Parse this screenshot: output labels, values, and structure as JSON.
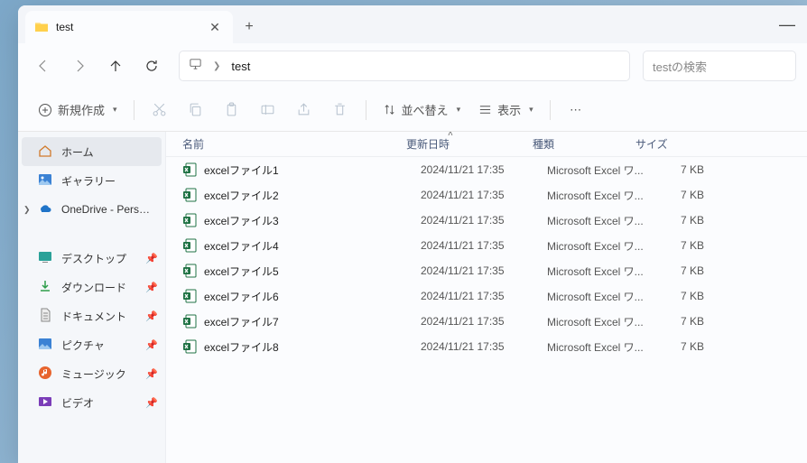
{
  "tab": {
    "title": "test"
  },
  "address": {
    "path": "test"
  },
  "search": {
    "placeholder": "testの検索"
  },
  "toolbar": {
    "new": "新規作成",
    "sort": "並べ替え",
    "view": "表示"
  },
  "sidebar": {
    "home": "ホーム",
    "gallery": "ギャラリー",
    "onedrive": "OneDrive - Pers…",
    "desktop": "デスクトップ",
    "downloads": "ダウンロード",
    "documents": "ドキュメント",
    "pictures": "ピクチャ",
    "music": "ミュージック",
    "videos": "ビデオ"
  },
  "columns": {
    "name": "名前",
    "date": "更新日時",
    "type": "種類",
    "size": "サイズ"
  },
  "files": [
    {
      "name": "excelファイル1",
      "date": "2024/11/21 17:35",
      "type": "Microsoft Excel ワ...",
      "size": "7 KB"
    },
    {
      "name": "excelファイル2",
      "date": "2024/11/21 17:35",
      "type": "Microsoft Excel ワ...",
      "size": "7 KB"
    },
    {
      "name": "excelファイル3",
      "date": "2024/11/21 17:35",
      "type": "Microsoft Excel ワ...",
      "size": "7 KB"
    },
    {
      "name": "excelファイル4",
      "date": "2024/11/21 17:35",
      "type": "Microsoft Excel ワ...",
      "size": "7 KB"
    },
    {
      "name": "excelファイル5",
      "date": "2024/11/21 17:35",
      "type": "Microsoft Excel ワ...",
      "size": "7 KB"
    },
    {
      "name": "excelファイル6",
      "date": "2024/11/21 17:35",
      "type": "Microsoft Excel ワ...",
      "size": "7 KB"
    },
    {
      "name": "excelファイル7",
      "date": "2024/11/21 17:35",
      "type": "Microsoft Excel ワ...",
      "size": "7 KB"
    },
    {
      "name": "excelファイル8",
      "date": "2024/11/21 17:35",
      "type": "Microsoft Excel ワ...",
      "size": "7 KB"
    }
  ]
}
